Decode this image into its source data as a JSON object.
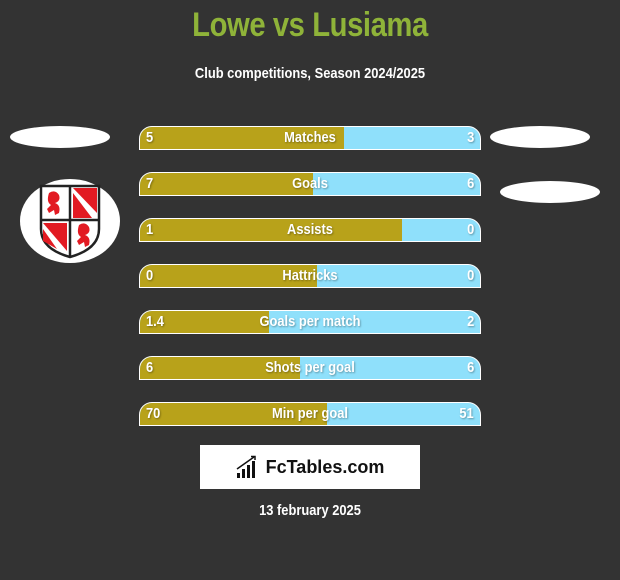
{
  "header": {
    "title": "Lowe vs Lusiama",
    "subtitle": "Club competitions, Season 2024/2025"
  },
  "colors": {
    "left_bar": "#b8a21a",
    "right_bar": "#8fe0fb",
    "title": "#8fb339",
    "background": "#333333"
  },
  "stats": [
    {
      "label": "Matches",
      "left": "5",
      "right": "3",
      "left_share": 0.6
    },
    {
      "label": "Goals",
      "left": "7",
      "right": "6",
      "left_share": 0.51
    },
    {
      "label": "Assists",
      "left": "1",
      "right": "0",
      "left_share": 0.77
    },
    {
      "label": "Hattricks",
      "left": "0",
      "right": "0",
      "left_share": 0.52
    },
    {
      "label": "Goals per match",
      "left": "1.4",
      "right": "2",
      "left_share": 0.38
    },
    {
      "label": "Shots per goal",
      "left": "6",
      "right": "6",
      "left_share": 0.47
    },
    {
      "label": "Min per goal",
      "left": "70",
      "right": "51",
      "left_share": 0.55
    }
  ],
  "brand": {
    "name": "FcTables.com",
    "icon": "bar-chart-icon"
  },
  "footer": {
    "date": "13 february 2025"
  },
  "team_logo": {
    "icon": "shield-crest-icon"
  }
}
